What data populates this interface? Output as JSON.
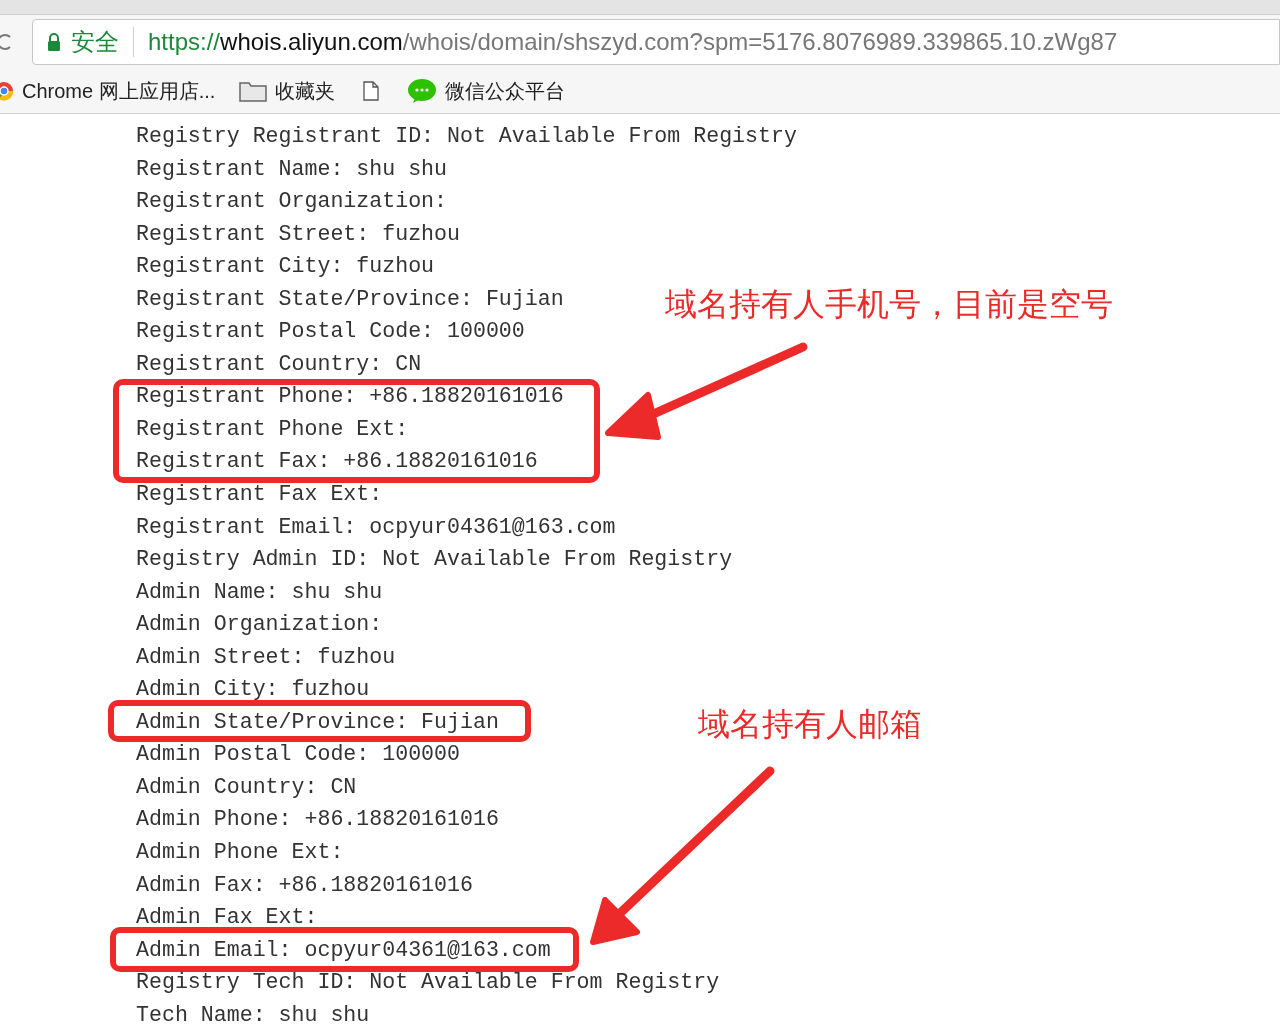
{
  "address_bar": {
    "security_label": "安全",
    "url_scheme": "https://",
    "url_host": "whois.aliyun.com",
    "url_path": "/whois/domain/shszyd.com?spm=5176.8076989.339865.10.zWg87"
  },
  "bookmarks": [
    {
      "kind": "app",
      "label": "Chrome 网上应用店..."
    },
    {
      "kind": "folder",
      "label": "收藏夹"
    },
    {
      "kind": "page"
    },
    {
      "kind": "wechat",
      "label": "微信公众平台"
    }
  ],
  "whois_lines": [
    "Registry Registrant ID: Not Available From Registry",
    "Registrant Name: shu shu",
    "Registrant Organization:",
    "Registrant Street: fuzhou",
    "Registrant City: fuzhou",
    "Registrant State/Province: Fujian",
    "Registrant Postal Code: 100000",
    "Registrant Country: CN",
    "Registrant Phone: +86.18820161016",
    "Registrant Phone Ext:",
    "Registrant Fax: +86.18820161016",
    "Registrant Fax Ext:",
    "Registrant Email: ocpyur04361@163.com",
    "Registry Admin ID: Not Available From Registry",
    "Admin Name: shu shu",
    "Admin Organization:",
    "Admin Street: fuzhou",
    "Admin City: fuzhou",
    "Admin State/Province: Fujian",
    "Admin Postal Code: 100000",
    "Admin Country: CN",
    "Admin Phone: +86.18820161016",
    "Admin Phone Ext:",
    "Admin Fax: +86.18820161016",
    "Admin Fax Ext:",
    "Admin Email: ocpyur04361@163.com",
    "Registry Tech ID: Not Available From Registry",
    "Tech Name: shu shu"
  ],
  "callouts": [
    "域名持有人手机号，目前是空号",
    "域名持有人邮箱"
  ]
}
